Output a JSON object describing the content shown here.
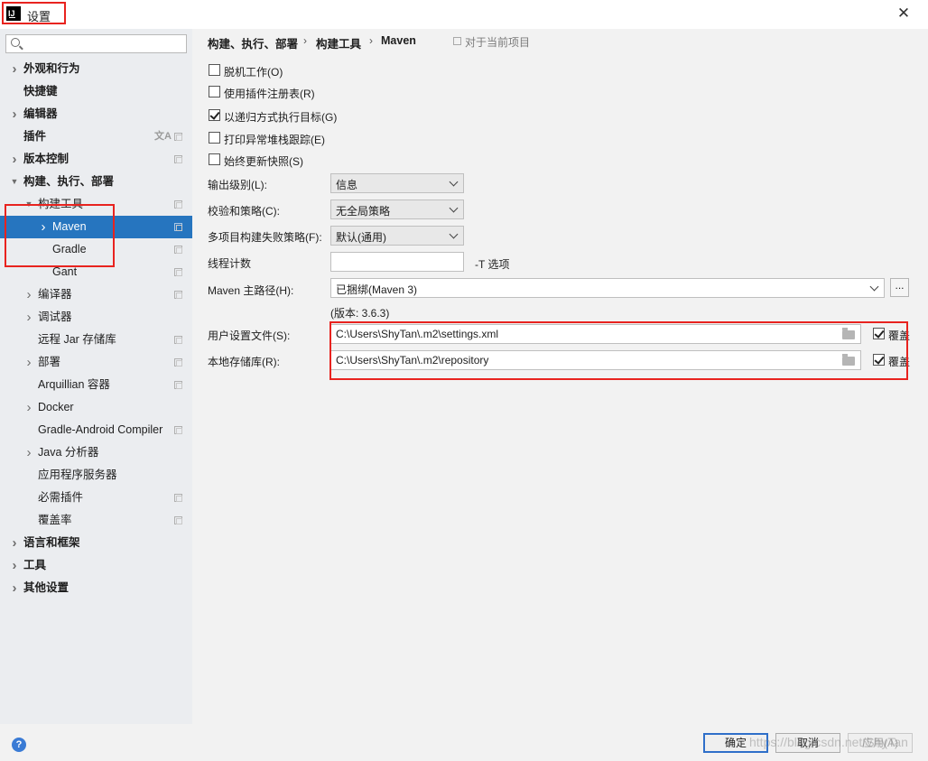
{
  "window": {
    "title": "设置",
    "app_icon_text": "IJ",
    "close_symbol": "✕"
  },
  "sidebar": {
    "search_placeholder": "",
    "items": [
      {
        "label": "外观和行为",
        "arrow": "right",
        "bold": true
      },
      {
        "label": "快捷键",
        "arrow": "",
        "bold": true
      },
      {
        "label": "编辑器",
        "arrow": "right",
        "bold": true
      },
      {
        "label": "插件",
        "arrow": "",
        "bold": true,
        "trans": "文A"
      },
      {
        "label": "版本控制",
        "arrow": "right",
        "bold": true
      },
      {
        "label": "构建、执行、部署",
        "arrow": "down",
        "bold": true
      },
      {
        "label": "构建工具",
        "arrow": "down"
      },
      {
        "label": "Maven",
        "arrow": "right",
        "selected": true
      },
      {
        "label": "Gradle",
        "arrow": ""
      },
      {
        "label": "Gant",
        "arrow": ""
      },
      {
        "label": "编译器",
        "arrow": "right"
      },
      {
        "label": "调试器",
        "arrow": "right"
      },
      {
        "label": "远程 Jar 存储库",
        "arrow": ""
      },
      {
        "label": "部署",
        "arrow": "right"
      },
      {
        "label": "Arquillian 容器",
        "arrow": ""
      },
      {
        "label": "Docker",
        "arrow": "right"
      },
      {
        "label": "Gradle-Android Compiler",
        "arrow": ""
      },
      {
        "label": "Java 分析器",
        "arrow": "right"
      },
      {
        "label": "应用程序服务器",
        "arrow": ""
      },
      {
        "label": "必需插件",
        "arrow": ""
      },
      {
        "label": "覆盖率",
        "arrow": ""
      },
      {
        "label": "语言和框架",
        "arrow": "right",
        "bold": true
      },
      {
        "label": "工具",
        "arrow": "right",
        "bold": true
      },
      {
        "label": "其他设置",
        "arrow": "right",
        "bold": true
      }
    ]
  },
  "breadcrumb": {
    "items": [
      "构建、执行、部署",
      "构建工具",
      "Maven"
    ],
    "separator": "›",
    "project_hint": "对于当前项目"
  },
  "options": {
    "offline": {
      "label": "脱机工作(O)",
      "checked": false
    },
    "plugin_registry": {
      "label": "使用插件注册表(R)",
      "checked": false
    },
    "recursive": {
      "label": "以递归方式执行目标(G)",
      "checked": true
    },
    "print_stack": {
      "label": "打印异常堆栈跟踪(E)",
      "checked": false
    },
    "always_update": {
      "label": "始终更新快照(S)",
      "checked": false
    }
  },
  "fields": {
    "output_level": {
      "label": "输出级别(L):",
      "value": "信息"
    },
    "checksum_policy": {
      "label": "校验和策略(C):",
      "value": "无全局策略"
    },
    "fail_policy": {
      "label": "多项目构建失败策略(F):",
      "value": "默认(通用)"
    },
    "thread_count": {
      "label": "线程计数",
      "value": "",
      "suffix": "-T 选项"
    },
    "maven_home": {
      "label": "Maven 主路径(H):",
      "value": "已捆绑(Maven 3)",
      "button": "..."
    },
    "version": "(版本: 3.6.3)",
    "user_settings": {
      "label": "用户设置文件(S):",
      "value": "C:\\Users\\ShyTan\\.m2\\settings.xml",
      "override_label": "覆盖",
      "override_checked": true
    },
    "local_repo": {
      "label": "本地存储库(R):",
      "value": "C:\\Users\\ShyTan\\.m2\\repository",
      "override_label": "覆盖",
      "override_checked": true
    }
  },
  "footer": {
    "help": "?",
    "ok": "确定",
    "cancel": "取消",
    "apply": "应用(A)",
    "watermark": "https://blog.csdn.net/ShyTan"
  },
  "colors": {
    "selection": "#2675bf",
    "highlight": "#e8231f"
  }
}
